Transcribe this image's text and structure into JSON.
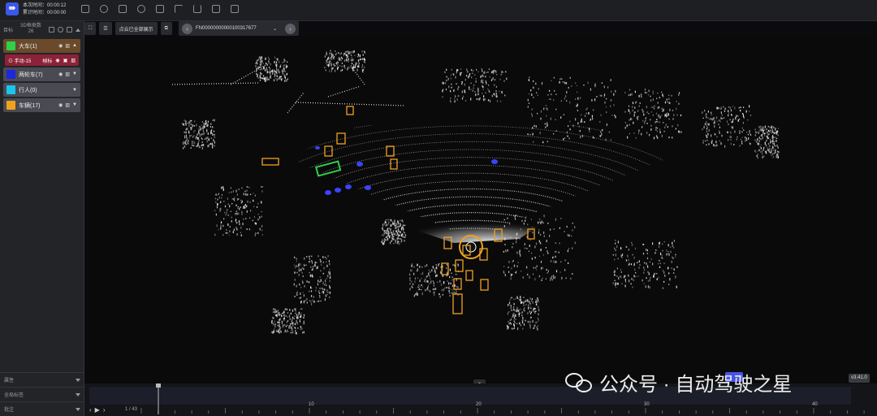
{
  "header": {
    "logo": "⇛",
    "time_this_label": "本次时间：00:00:12",
    "time_total_label": "累计时间：00:00:00",
    "toolbar_icons": [
      "cube-icon",
      "settings-icon",
      "image-icon",
      "rotate-icon",
      "tag-icon",
      "chart-icon",
      "flag-icon",
      "layers-icon",
      "grid-icon"
    ]
  },
  "sidebar": {
    "head_left": "目标",
    "head_mid": "3D框类数",
    "head_mid_count": "26",
    "categories": [
      {
        "label": "大车(1)",
        "color": "#2fd14a",
        "bg": "#6a4a2a",
        "arrow": "▲"
      },
      {
        "label": "两轮车(7)",
        "color": "#1f25e0",
        "bg": "#4a4b52",
        "arrow": "▼"
      },
      {
        "label": "行人(0)",
        "color": "#18c6f0",
        "bg": "#4a4b52",
        "arrow": "▼"
      },
      {
        "label": "车辆(17)",
        "color": "#f0a21e",
        "bg": "#4a4b52",
        "arrow": "▼"
      }
    ],
    "subitem": {
      "label": "⊙ 手动-15",
      "tag": "帧标"
    },
    "bottom_sections": [
      "属性",
      "全局标签",
      "批注"
    ]
  },
  "viewbar": {
    "fit_label": "⛶",
    "list_label": "☰",
    "pointcloud_label": "点云已全部展示",
    "copy_label": "⧉"
  },
  "frame": {
    "prev": "‹",
    "next": "›",
    "id": "FN00000000000100317677",
    "dropdown": "⌄"
  },
  "timeline": {
    "counter": "1 / 43",
    "play_controls": [
      "‹",
      "▶",
      "›"
    ],
    "ticks": [
      "10",
      "20",
      "30",
      "40"
    ],
    "collapse": "⌄"
  },
  "version": "v3.41.0",
  "watermark": "公众号 · 自动驾驶之星",
  "colors": {
    "accent": "#3c58e8",
    "box_vehicle": "#f0a21e",
    "box_truck": "#2fd14a",
    "box_cyclist": "#3a44ff"
  }
}
